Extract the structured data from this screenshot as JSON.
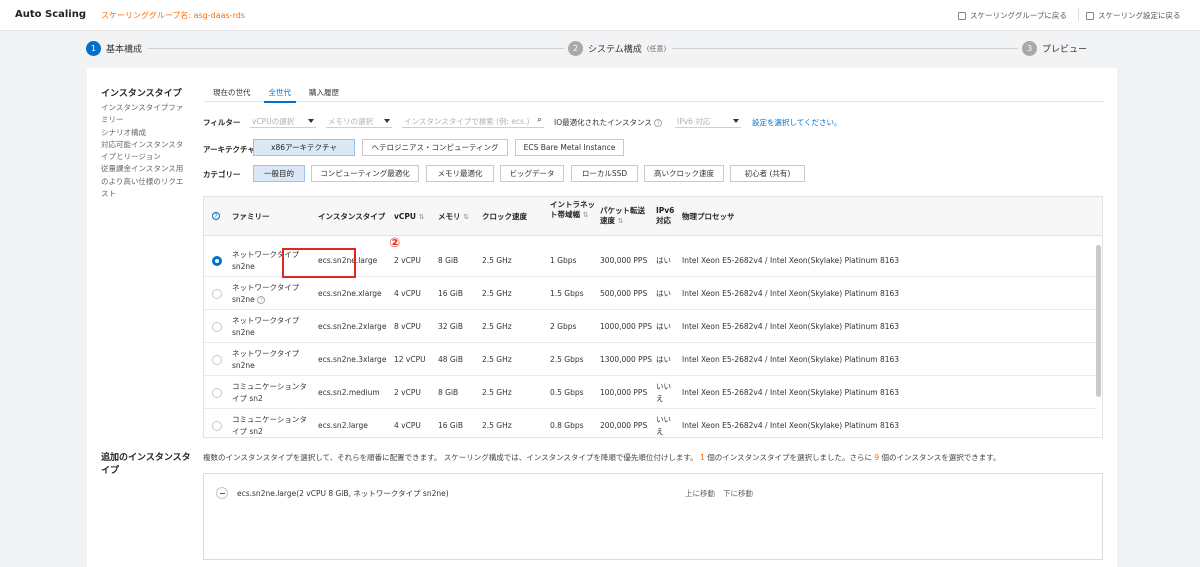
{
  "header": {
    "app_title": "Auto Scaling",
    "group_name": "スケーリンググループ名: asg-daas-rds",
    "back_to_group": "スケーリンググループに戻る",
    "back_to_config": "スケーリング設定に戻る"
  },
  "steps": [
    {
      "num": "1",
      "label": "基本構成",
      "optional": "",
      "state": "active"
    },
    {
      "num": "2",
      "label": "システム構成",
      "optional": "(任意)",
      "state": "inactive"
    },
    {
      "num": "3",
      "label": "プレビュー",
      "optional": "",
      "state": "inactive"
    }
  ],
  "instance_type": {
    "title": "インスタンスタイプ",
    "description": "インスタンスタイプファミリー\nシナリオ構成\n対応可能インスタンスタイプとリージョン\n従量課金インスタンス用のより高い仕様のリクエスト",
    "tabs": [
      "現在の世代",
      "全世代",
      "購入履歴"
    ],
    "active_tab": "全世代",
    "filter_label": "フィルター",
    "vcpu_placeholder": "vCPUの選択",
    "memory_placeholder": "メモリの選択",
    "search_placeholder": "インスタンスタイプで検索 (例: ecs.)",
    "io_label": "IO最適化されたインスタンス",
    "ipv6_placeholder": "IPv6 対応",
    "settings_link": "設定を選択してください。",
    "arch_label": "アーキテクチャ",
    "arch_options": [
      "x86アーキテクチャ",
      "ヘテロジニアス・コンピューティング",
      "ECS Bare Metal Instance"
    ],
    "category_label": "カテゴリー",
    "category_options": [
      "一般目的",
      "コンピューティング最適化",
      "メモリ最適化",
      "ビッグデータ",
      "ローカルSSD",
      "高いクロック速度",
      "初心者 (共有)"
    ]
  },
  "table": {
    "headers": {
      "family": "ファミリー",
      "type": "インスタンスタイプ",
      "vcpu": "vCPU",
      "memory": "メモリ",
      "clock": "クロック速度",
      "bandwidth": "イントラネット帯域幅",
      "pps": "パケット転送速度",
      "ipv6": "IPv6対応",
      "processor": "物理プロセッサ"
    },
    "rows": [
      {
        "family": "ネットワークタイプ sn2ne",
        "type": "ecs.sn2ne.large",
        "vcpu": "2 vCPU",
        "memory": "8 GiB",
        "clock": "2.5 GHz",
        "bandwidth": "1 Gbps",
        "pps": "300,000 PPS",
        "ipv6": "はい",
        "processor": "Intel Xeon E5-2682v4 / Intel Xeon(Skylake) Platinum 8163",
        "selected": true
      },
      {
        "family": "ネットワークタイプ sn2ne",
        "type": "ecs.sn2ne.xlarge",
        "vcpu": "4 vCPU",
        "memory": "16 GiB",
        "clock": "2.5 GHz",
        "bandwidth": "1.5 Gbps",
        "pps": "500,000 PPS",
        "ipv6": "はい",
        "processor": "Intel Xeon E5-2682v4 / Intel Xeon(Skylake) Platinum 8163",
        "selected": false
      },
      {
        "family": "ネットワークタイプ sn2ne",
        "type": "ecs.sn2ne.2xlarge",
        "vcpu": "8 vCPU",
        "memory": "32 GiB",
        "clock": "2.5 GHz",
        "bandwidth": "2 Gbps",
        "pps": "1000,000 PPS",
        "ipv6": "はい",
        "processor": "Intel Xeon E5-2682v4 / Intel Xeon(Skylake) Platinum 8163",
        "selected": false
      },
      {
        "family": "ネットワークタイプ sn2ne",
        "type": "ecs.sn2ne.3xlarge",
        "vcpu": "12 vCPU",
        "memory": "48 GiB",
        "clock": "2.5 GHz",
        "bandwidth": "2.5 Gbps",
        "pps": "1300,000 PPS",
        "ipv6": "はい",
        "processor": "Intel Xeon E5-2682v4 / Intel Xeon(Skylake) Platinum 8163",
        "selected": false
      },
      {
        "family": "コミュニケーションタイプ sn2",
        "type": "ecs.sn2.medium",
        "vcpu": "2 vCPU",
        "memory": "8 GiB",
        "clock": "2.5 GHz",
        "bandwidth": "0.5 Gbps",
        "pps": "100,000 PPS",
        "ipv6": "いいえ",
        "processor": "Intel Xeon E5-2682v4 / Intel Xeon(Skylake) Platinum 8163",
        "selected": false
      },
      {
        "family": "コミュニケーションタイプ sn2",
        "type": "ecs.sn2.large",
        "vcpu": "4 vCPU",
        "memory": "16 GiB",
        "clock": "2.5 GHz",
        "bandwidth": "0.8 Gbps",
        "pps": "200,000 PPS",
        "ipv6": "いいえ",
        "processor": "Intel Xeon E5-2682v4 / Intel Xeon(Skylake) Platinum 8163",
        "selected": false
      }
    ]
  },
  "annotation_marker": "②",
  "additional": {
    "title": "追加のインスタンスタイプ",
    "desc_pre": "複数のインスタンスタイプを選択して、それらを順番に配置できます。 スケーリング構成では、インスタンスタイプを降順で優先順位付けします。",
    "selected_count": "1",
    "desc_mid": "個のインスタンスタイプを選択しました。さらに",
    "remaining_count": "9",
    "desc_post": "個のインスタンスを選択できます。",
    "item": "ecs.sn2ne.large(2 vCPU 8 GiB, ネットワークタイプ sn2ne)",
    "move_up": "上に移動",
    "move_down": "下に移動"
  },
  "colors": {
    "accent": "#0070cc",
    "brand": "#ff6a00",
    "highlight": "#e3271c"
  }
}
